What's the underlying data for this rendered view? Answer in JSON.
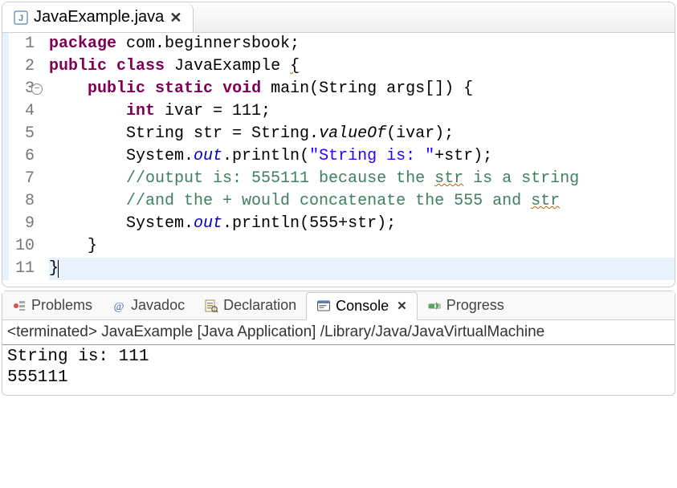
{
  "editor": {
    "tab": {
      "filename": "JavaExample.java"
    },
    "lines": [
      {
        "n": 1,
        "tokens": [
          [
            "kw",
            "package"
          ],
          [
            "",
            " com.beginnersbook;"
          ]
        ]
      },
      {
        "n": 2,
        "tokens": [
          [
            "kw",
            "public"
          ],
          [
            "",
            " "
          ],
          [
            "kw",
            "class"
          ],
          [
            "",
            " JavaExample "
          ],
          [
            "warn",
            "{"
          ]
        ]
      },
      {
        "n": 3,
        "fold": true,
        "tokens": [
          [
            "",
            "    "
          ],
          [
            "kw",
            "public"
          ],
          [
            "",
            " "
          ],
          [
            "kw",
            "static"
          ],
          [
            "",
            " "
          ],
          [
            "kw",
            "void"
          ],
          [
            "",
            " main(String args[]) {"
          ]
        ]
      },
      {
        "n": 4,
        "tokens": [
          [
            "",
            "        "
          ],
          [
            "kw",
            "int"
          ],
          [
            "",
            " ivar = 111;"
          ]
        ]
      },
      {
        "n": 5,
        "tokens": [
          [
            "",
            "        String str = String."
          ],
          [
            "smth",
            "valueOf"
          ],
          [
            "",
            "(ivar);"
          ]
        ]
      },
      {
        "n": 6,
        "tokens": [
          [
            "",
            "        System."
          ],
          [
            "sfld",
            "out"
          ],
          [
            "",
            ".println("
          ],
          [
            "str",
            "\"String is: \""
          ],
          [
            "",
            "+str);"
          ]
        ]
      },
      {
        "n": 7,
        "tokens": [
          [
            "",
            "        "
          ],
          [
            "com",
            "//output is: 555111 because the "
          ],
          [
            "com warn",
            "str"
          ],
          [
            "com",
            " is a string"
          ]
        ]
      },
      {
        "n": 8,
        "tokens": [
          [
            "",
            "        "
          ],
          [
            "com",
            "//and the + would concatenate the 555 and "
          ],
          [
            "com warn",
            "str"
          ]
        ]
      },
      {
        "n": 9,
        "tokens": [
          [
            "",
            "        System."
          ],
          [
            "sfld",
            "out"
          ],
          [
            "",
            ".println(555+str);"
          ]
        ]
      },
      {
        "n": 10,
        "tokens": [
          [
            "",
            "    }"
          ]
        ]
      },
      {
        "n": 11,
        "hl": true,
        "cursor_after": true,
        "tokens": [
          [
            "",
            "}"
          ]
        ]
      }
    ]
  },
  "views": {
    "tabs": [
      {
        "id": "problems",
        "label": "Problems",
        "icon": "problems-icon"
      },
      {
        "id": "javadoc",
        "label": "Javadoc",
        "icon": "javadoc-icon"
      },
      {
        "id": "declaration",
        "label": "Declaration",
        "icon": "declaration-icon"
      },
      {
        "id": "console",
        "label": "Console",
        "icon": "console-icon",
        "active": true,
        "closable": true
      },
      {
        "id": "progress",
        "label": "Progress",
        "icon": "progress-icon"
      }
    ],
    "console": {
      "status": "<terminated> JavaExample [Java Application] /Library/Java/JavaVirtualMachine",
      "output": "String is: 111\n555111"
    }
  }
}
